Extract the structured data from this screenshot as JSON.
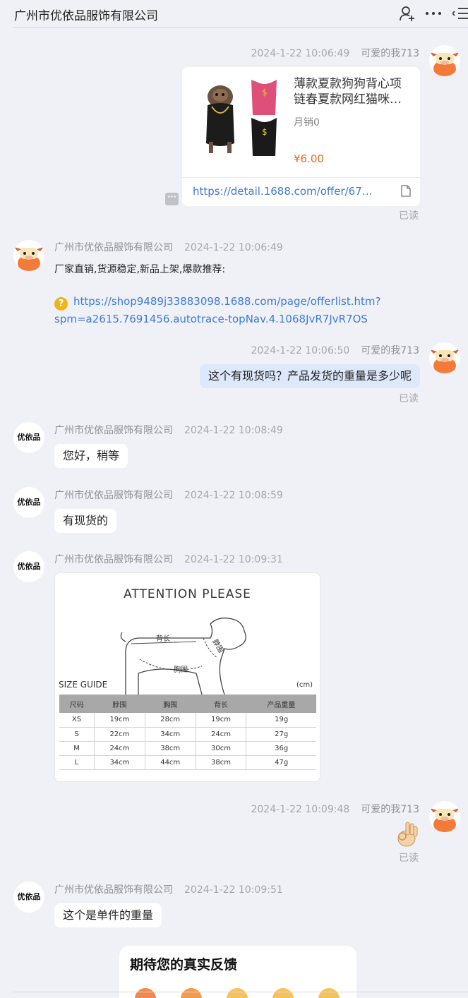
{
  "header": {
    "title": "广州市优依品服饰有限公司"
  },
  "shop_name": "广州市优依品服饰有限公司",
  "me_name": "可爱的我713",
  "shop_avatar_text": "优依品",
  "read_label": "已读",
  "messages": {
    "m1": {
      "time": "2024-1-22 10:06:49"
    },
    "product": {
      "title": "薄款夏款狗狗背心项链春夏款网红猫咪…",
      "sales": "月销0",
      "price": "¥6.00",
      "link": "https://detail.1688.com/offer/67…"
    },
    "m2": {
      "time": "2024-1-22 10:06:49",
      "text": "厂家直销,货源稳定,新品上架,爆款推荐:",
      "link": "https://shop9489j33883098.1688.com/page/offerlist.htm?spm=a2615.7691456.autotrace-topNav.4.1068JvR7JvR7OS"
    },
    "m3": {
      "time": "2024-1-22 10:06:50",
      "text": "这个有现货吗？产品发货的重量是多少呢"
    },
    "m4": {
      "time": "2024-1-22 10:08:49",
      "text": "您好，稍等"
    },
    "m5": {
      "time": "2024-1-22 10:08:59",
      "text": "有现货的"
    },
    "m6": {
      "time": "2024-1-22 10:09:31"
    },
    "m7": {
      "time": "2024-1-22 10:09:48"
    },
    "m8": {
      "time": "2024-1-22 10:09:51",
      "text": "这个是单件的重量"
    }
  },
  "size_guide": {
    "title": "ATTENTION PLEASE",
    "subtitle": "SIZE GUIDE",
    "unit": "(cm)",
    "diagram_labels": {
      "back": "背长",
      "neck": "脖围",
      "chest": "胸围"
    },
    "headers": [
      "尺码",
      "脖围",
      "胸围",
      "背长",
      "产品重量"
    ],
    "rows": [
      [
        "XS",
        "19cm",
        "28cm",
        "19cm",
        "19g"
      ],
      [
        "S",
        "22cm",
        "34cm",
        "24cm",
        "27g"
      ],
      [
        "M",
        "24cm",
        "38cm",
        "30cm",
        "36g"
      ],
      [
        "L",
        "34cm",
        "44cm",
        "38cm",
        "47g"
      ]
    ]
  },
  "feedback": {
    "title": "期待您的真实反馈"
  },
  "colors": {
    "accent_link": "#3c7bd6",
    "price": "#e66a1f",
    "my_bubble": "#dde8fb"
  }
}
